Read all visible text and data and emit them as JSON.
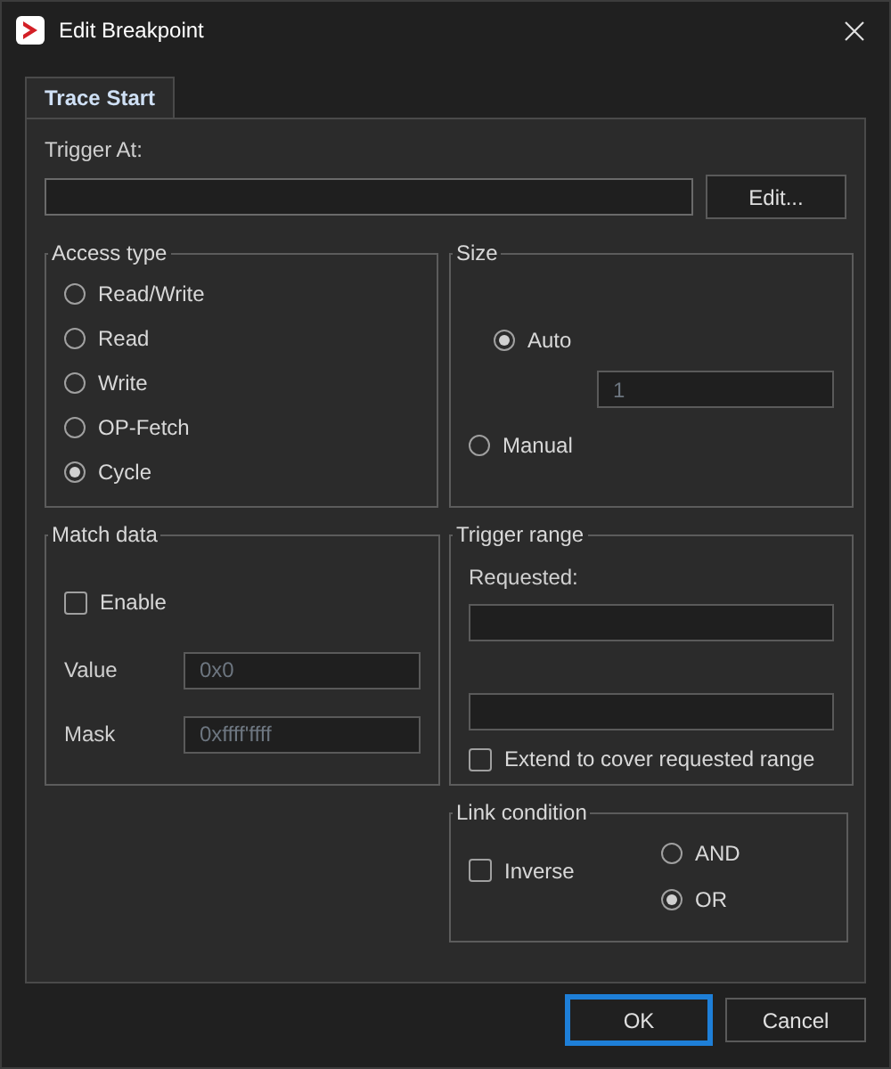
{
  "window": {
    "title": "Edit Breakpoint"
  },
  "tabs": [
    {
      "label": "Trace Start",
      "selected": true
    }
  ],
  "trigger_at": {
    "label": "Trigger At:",
    "button": "Edit..."
  },
  "access_type": {
    "title": "Access type",
    "options": [
      {
        "label": "Read/Write",
        "selected": false
      },
      {
        "label": "Read",
        "selected": false
      },
      {
        "label": "Write",
        "selected": false
      },
      {
        "label": "OP-Fetch",
        "selected": false
      },
      {
        "label": "Cycle",
        "selected": true
      }
    ]
  },
  "size": {
    "title": "Size",
    "options": [
      {
        "label": "Auto",
        "selected": true
      },
      {
        "label": "Manual",
        "selected": false
      }
    ],
    "value": "1"
  },
  "match_data": {
    "title": "Match data",
    "enable": {
      "label": "Enable",
      "checked": false
    },
    "fields": [
      {
        "label": "Value",
        "value": "0x0"
      },
      {
        "label": "Mask",
        "value": "0xffff'ffff"
      }
    ]
  },
  "trigger_range": {
    "title": "Trigger range",
    "requested_label": "Requested:",
    "extend": {
      "label": "Extend to cover requested range",
      "checked": false
    }
  },
  "link_condition": {
    "title": "Link condition",
    "inverse": {
      "label": "Inverse",
      "checked": false
    },
    "options": [
      {
        "label": "AND",
        "selected": false
      },
      {
        "label": "OR",
        "selected": true
      }
    ]
  },
  "buttons": [
    {
      "label": "OK",
      "default": true
    },
    {
      "label": "Cancel",
      "default": false
    }
  ]
}
